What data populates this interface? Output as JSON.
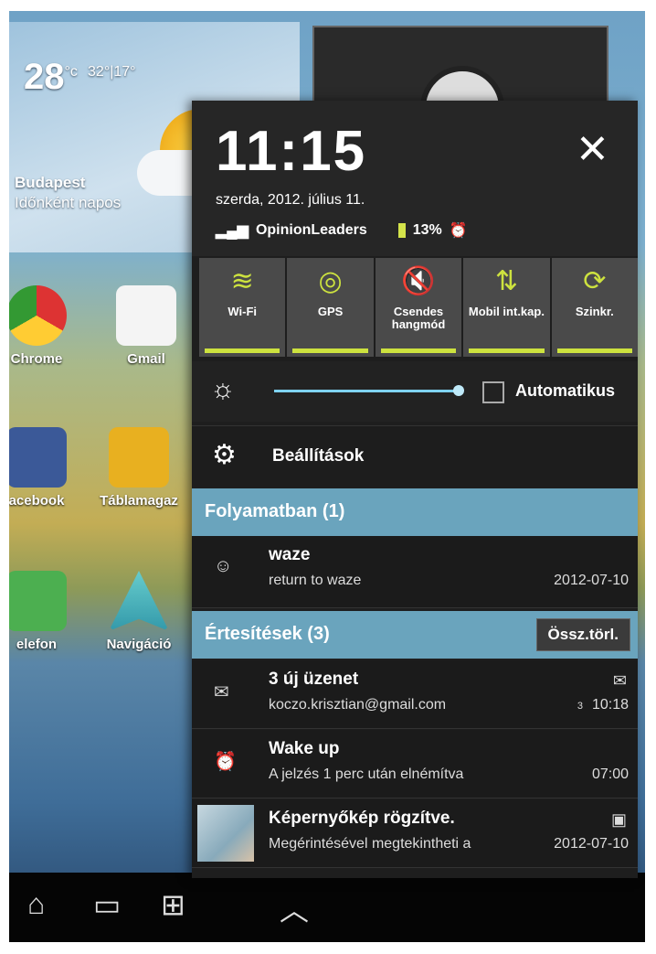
{
  "home": {
    "weather": {
      "temp": "28",
      "unit": "°c",
      "range": "32°|17°",
      "city": "Budapest",
      "condition": "Időnként napos"
    },
    "apps": [
      {
        "label": "Chrome",
        "icon": "chrome-icon"
      },
      {
        "label": "Gmail",
        "icon": "gmail-icon"
      },
      {
        "label": "acebook",
        "icon": "facebook-icon"
      },
      {
        "label": "Táblamagaz",
        "icon": "magazine-icon"
      },
      {
        "label": "elefon",
        "icon": "phone-icon"
      },
      {
        "label": "Navigáció",
        "icon": "navigation-icon"
      }
    ],
    "nav": {
      "home": "⌂",
      "recent": "▭",
      "screenshot": "⊞",
      "up": "︿"
    }
  },
  "panel": {
    "time": "11:15",
    "close": "✕",
    "date": "szerda, 2012. július 11.",
    "carrier": "OpinionLeaders",
    "battery": "13%",
    "toggles": [
      {
        "label": "Wi-Fi",
        "icon": "wifi-icon",
        "glyph": "≋"
      },
      {
        "label": "GPS",
        "icon": "gps-icon",
        "glyph": "◎"
      },
      {
        "label": "Csendes hangmód",
        "icon": "mute-icon",
        "glyph": "🔇"
      },
      {
        "label": "Mobil int.kap.",
        "icon": "mobile-data-icon",
        "glyph": "⇅"
      },
      {
        "label": "Szinkr.",
        "icon": "sync-icon",
        "glyph": "⟳"
      }
    ],
    "brightness": {
      "level": 1.0,
      "auto_label": "Automatikus",
      "auto": false
    },
    "settings_label": "Beállítások",
    "ongoing": {
      "header": "Folyamatban (1)",
      "items": [
        {
          "title": "waze",
          "body": "return to waze",
          "date": "2012-07-10"
        }
      ]
    },
    "notifications": {
      "header": "Értesítések (3)",
      "clear_label": "Össz.törl.",
      "items": [
        {
          "title": "3 új üzenet",
          "body": "koczo.krisztian@gmail.com",
          "count": "3",
          "date": "10:18"
        },
        {
          "title": "Wake up",
          "body": "A jelzés 1 perc után elnémítva",
          "date": "07:00"
        },
        {
          "title": "Képernyőkép rögzítve.",
          "body": "Megérintésével megtekintheti a",
          "date": "2012-07-10"
        }
      ]
    }
  }
}
